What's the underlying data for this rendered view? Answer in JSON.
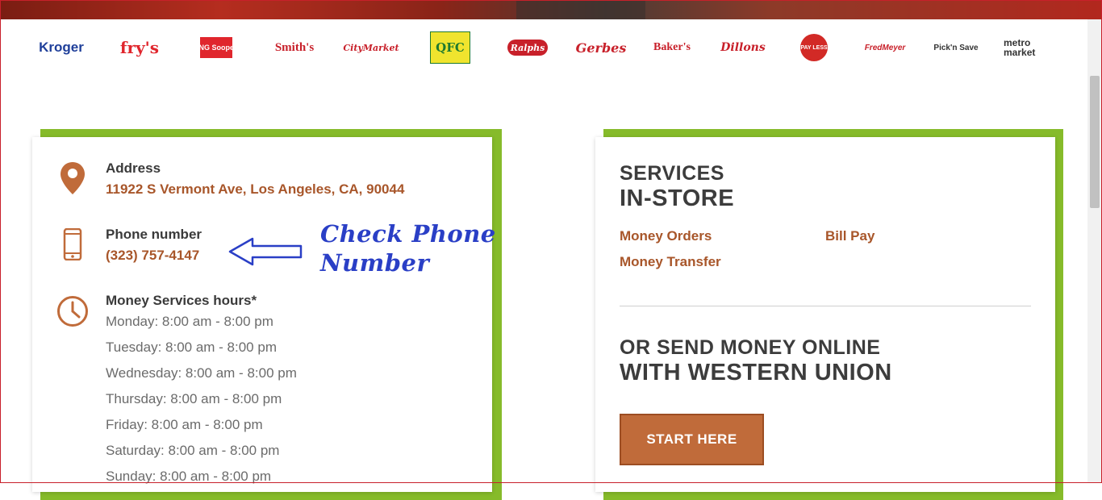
{
  "brands": [
    {
      "label": "Kroger",
      "color": "#1f3f9a"
    },
    {
      "label": "fry's",
      "color": "#e0262d"
    },
    {
      "label": "KING Soopers",
      "color": "#e0262d"
    },
    {
      "label": "Smith's",
      "color": "#c8202a"
    },
    {
      "label": "CityMarket",
      "color": "#c8202a"
    },
    {
      "label": "QFC",
      "color": "#1e7a2f"
    },
    {
      "label": "Ralphs",
      "color": "#c8202a"
    },
    {
      "label": "Gerbes",
      "color": "#c8202a"
    },
    {
      "label": "Baker's",
      "color": "#c8202a"
    },
    {
      "label": "Dillons",
      "color": "#c8202a"
    },
    {
      "label": "PAY LESS",
      "color": "#c8202a"
    },
    {
      "label": "FredMeyer",
      "color": "#c8202a"
    },
    {
      "label": "Pick'n Save",
      "color": "#333333"
    },
    {
      "label": "metro market",
      "color": "#333333"
    }
  ],
  "store": {
    "address_label": "Address",
    "address_value": "11922 S Vermont Ave, Los Angeles, CA, 90044",
    "phone_label": "Phone number",
    "phone_value": "(323) 757-4147",
    "hours_label": "Money Services hours*",
    "hours": [
      "Monday: 8:00 am - 8:00 pm",
      "Tuesday: 8:00 am - 8:00 pm",
      "Wednesday: 8:00 am - 8:00 pm",
      "Thursday: 8:00 am - 8:00 pm",
      "Friday: 8:00 am - 8:00 pm",
      "Saturday: 8:00 am - 8:00 pm",
      "Sunday: 8:00 am - 8:00 pm"
    ]
  },
  "annotation": {
    "line1": "Check Phone",
    "line2": "Number"
  },
  "services": {
    "title_line1": "SERVICES",
    "title_line2": "IN-STORE",
    "links": [
      "Money Orders",
      "Bill Pay",
      "Money Transfer"
    ],
    "send_line1": "OR SEND MONEY ONLINE",
    "send_line2": "WITH WESTERN UNION",
    "cta_label": "START HERE"
  },
  "colors": {
    "accent_green": "#86bb2a",
    "accent_brown": "#a8562a",
    "cta": "#c06b3a",
    "annotation_blue": "#2a3fc6"
  }
}
